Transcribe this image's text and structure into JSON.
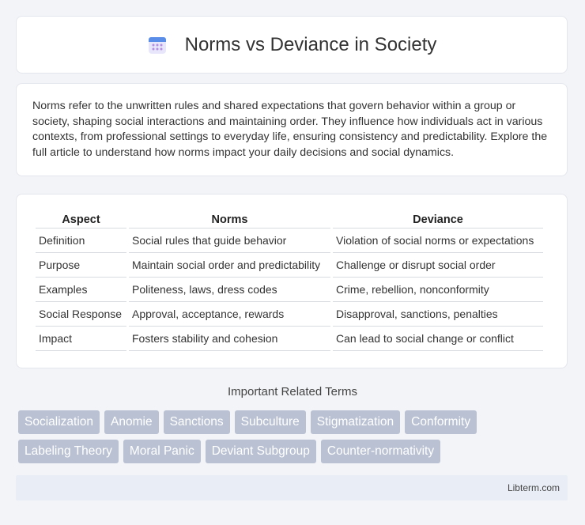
{
  "header": {
    "title": "Norms vs Deviance in Society",
    "icon": "calendar-icon"
  },
  "intro": {
    "text": "Norms refer to the unwritten rules and shared expectations that govern behavior within a group or society, shaping social interactions and maintaining order. They influence how individuals act in various contexts, from professional settings to everyday life, ensuring consistency and predictability. Explore the full article to understand how norms impact your daily decisions and social dynamics."
  },
  "table": {
    "headers": [
      "Aspect",
      "Norms",
      "Deviance"
    ],
    "rows": [
      [
        "Definition",
        "Social rules that guide behavior",
        "Violation of social norms or expectations"
      ],
      [
        "Purpose",
        "Maintain social order and predictability",
        "Challenge or disrupt social order"
      ],
      [
        "Examples",
        "Politeness, laws, dress codes",
        "Crime, rebellion, nonconformity"
      ],
      [
        "Social Response",
        "Approval, acceptance, rewards",
        "Disapproval, sanctions, penalties"
      ],
      [
        "Impact",
        "Fosters stability and cohesion",
        "Can lead to social change or conflict"
      ]
    ]
  },
  "related": {
    "title": "Important Related Terms",
    "tags": [
      "Socialization",
      "Anomie",
      "Sanctions",
      "Subculture",
      "Stigmatization",
      "Conformity",
      "Labeling Theory",
      "Moral Panic",
      "Deviant Subgroup",
      "Counter-normativity"
    ]
  },
  "footer": {
    "brand": "Libterm.com"
  },
  "colors": {
    "tag_bg": "#b9c1d3",
    "footer_bg": "#e9eef6",
    "page_bg": "#f3f4f7"
  }
}
